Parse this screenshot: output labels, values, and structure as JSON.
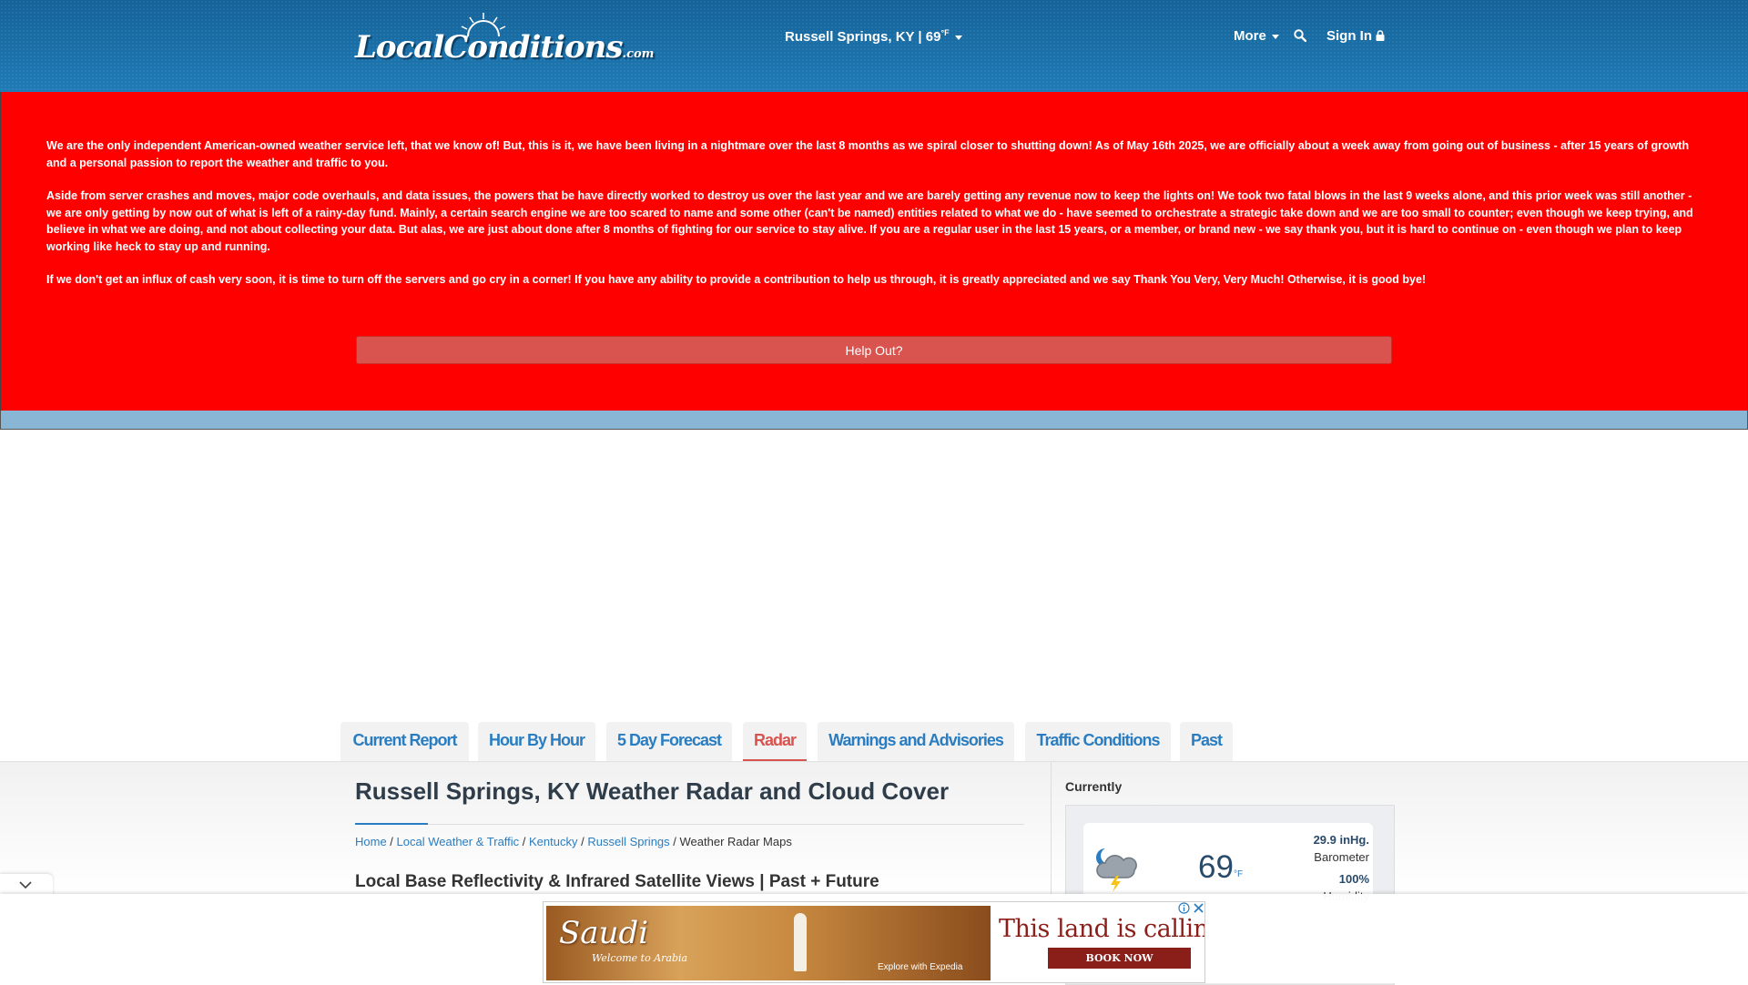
{
  "nav": {
    "logo_text": "LocalConditions",
    "logo_suffix": ".com",
    "location": "Russell Springs, KY | 69",
    "temp_unit": "°F",
    "more_label": "More",
    "signin_label": "Sign In",
    "icons": [
      "sun-icon",
      "search-icon",
      "lock-icon",
      "caret-down-icon"
    ]
  },
  "notice": {
    "paragraph1": "We are the only independent American-owned weather service left, that we know of! But, this is it, we have been living in a nightmare over the last 8 months as we spiral closer to shutting down! As of May 16th 2025, we are officially about a week away from going out of business - after 15 years of growth and a personal passion to report the weather and traffic to you.",
    "paragraph2": "Aside from server crashes and moves, major code overhauls, and data issues, the powers that be have directly worked to destroy us over the last year and we are barely getting any revenue now to keep the lights on! We took two fatal blows in the last 9 weeks alone, and this prior week was still another - we are only getting by now out of what is left of a rainy-day fund. Mainly, a certain search engine we are too scared to name and some other (can't be named) entities related to what we do - have seemed to orchestrate a strategic take down and we are too small to counter; even though we keep trying, and believe in what we are doing, and not about collecting your data. But alas, we are just about done after 8 months of fighting for our service to stay alive. If you are a regular user in the last 15 years, or a member, or brand new - we say thank you, but it is hard to continue on - even though we plan to keep working like heck to stay up and running.",
    "paragraph3": "If we don't get an influx of cash very soon, it is time to turn off the servers and go cry in a corner! If you have any ability to provide a contribution to help us through, it is greatly appreciated and we say Thank You Very, Very Much! Otherwise, it is good bye!",
    "button_label": "Help Out?",
    "background_color": "#ff0000"
  },
  "tabs": [
    {
      "label": "Current Report",
      "active": false
    },
    {
      "label": "Hour By Hour",
      "active": false
    },
    {
      "label": "5 Day Forecast",
      "active": false
    },
    {
      "label": "Radar",
      "active": true
    },
    {
      "label": "Warnings and Advisories",
      "active": false
    },
    {
      "label": "Traffic Conditions",
      "active": false
    },
    {
      "label": "Past",
      "active": false
    }
  ],
  "main": {
    "title": "Russell Springs, KY Weather Radar and Cloud Cover",
    "breadcrumb": {
      "home": "Home",
      "local": "Local Weather & Traffic",
      "state": "Kentucky",
      "city": "Russell Springs",
      "current": "Weather Radar Maps",
      "separator": " / "
    },
    "subtitle": "Local Base Reflectivity & Infrared Satellite Views | Past + Future"
  },
  "sidebar": {
    "currently_label": "Currently",
    "temperature": "69",
    "temperature_unit": "°F",
    "barometer_value": "29.9 inHg.",
    "barometer_label": "Barometer",
    "humidity_value": "100%",
    "humidity_label": "Humidity",
    "weather_icon": "night-thunderstorm-icon"
  },
  "ad": {
    "brand": "Saudi",
    "welcome": "Welcome to Arabia",
    "partner": "Explore with Expedia",
    "headline": "This land is calling",
    "cta": "BOOK NOW",
    "accent_color": "#8a1f1a"
  },
  "colors": {
    "header_blue": "#1d78b3",
    "link_blue": "#2a7dc0",
    "active_tab_red": "#d9534f"
  }
}
